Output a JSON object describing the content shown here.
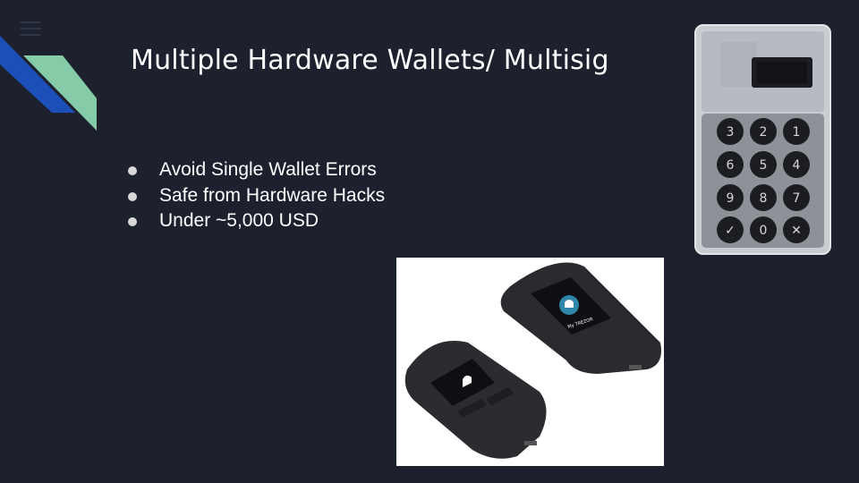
{
  "slide": {
    "title": "Multiple Hardware Wallets/ Multisig",
    "bullets": [
      "Avoid Single Wallet Errors",
      "Safe from Hardware Hacks",
      "Under ~5,000 USD"
    ]
  },
  "images": {
    "coldcard": {
      "icon": "coldcard-wallet-image",
      "keypad_keys": [
        "3",
        "2",
        "1",
        "6",
        "5",
        "4",
        "9",
        "8",
        "7",
        "✓",
        "0",
        "✕"
      ]
    },
    "trezor": {
      "icon": "trezor-wallets-image",
      "screen_text": "My TREZOR"
    }
  },
  "colors": {
    "background": "#1d212e",
    "accent_blue": "#1c4fb8",
    "accent_green": "#86cba7",
    "text": "#ffffff"
  }
}
